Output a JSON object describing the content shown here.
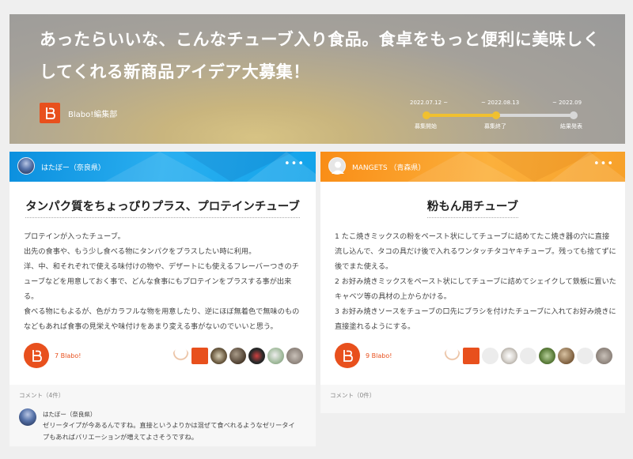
{
  "hero": {
    "title": "あったらいいな、こんなチューブ入り食品。食卓をもっと便利に美味しくしてくれる新商品アイデア大募集！",
    "organizer": "Blabo!編集部",
    "timeline": [
      {
        "date": "2022.07.12 ~",
        "label": "募集開始"
      },
      {
        "date": "~ 2022.08.13",
        "label": "募集終了"
      },
      {
        "date": "~ 2022.09",
        "label": "結果発表"
      }
    ]
  },
  "colors": {
    "brand": "#e8501d",
    "card_a_header": "#1aa0ea",
    "card_b_header": "#f9a02a",
    "timeline_active": "#f0c030"
  },
  "ideas": [
    {
      "author": "はたぼー（奈良県）",
      "title": "タンパク質をちょっぴりプラス、プロテインチューブ",
      "body": [
        "プロテインが入ったチューブ。",
        "出先の食事や、もう少し食べる物にタンパクをプラスしたい時に利用。",
        "洋、中、和それぞれで使える味付けの物や、デザートにも使えるフレーバーつきのチューブなどを用意しておく事で、どんな食事にもプロテインをプラスする事が出来る。",
        "食べる物にもよるが、色がカラフルな物を用意したり、逆にほぼ無着色で無味のものなどもあれば食事の見栄えや味付けをあまり変える事がないのでいいと思う。"
      ],
      "blabo_count": "7 Blabo!",
      "comments_label": "コメント（4件）",
      "comment": {
        "author": "はたぼー（奈良県）",
        "text": "ゼリータイプが今あるんですね。直接というよりかは混ぜて食べれるようなゼリータイプもあればバリエーションが増えてよさそうですね。"
      }
    },
    {
      "author": "MANGETS （青森県）",
      "title": "粉もん用チューブ",
      "body": [
        "1 たこ焼きミックスの粉をペースト状にしてチューブに詰めてたこ焼き器の穴に直接流し込んで、タコの具だけ後で入れるワンタッチタコヤキチューブ。残っても捨てずに後でまた使える。",
        "2 お好み焼きミックスをペースト状にしてチューブに詰めてシェイクして鉄板に置いたキャベツ等の具材の上からかける。",
        "3 お好み焼きソースをチューブの口先にブラシを付けたチューブに入れてお好み焼きに直接塗れるようにする。"
      ],
      "blabo_count": "9 Blabo!",
      "comments_label": "コメント（0件）"
    }
  ]
}
